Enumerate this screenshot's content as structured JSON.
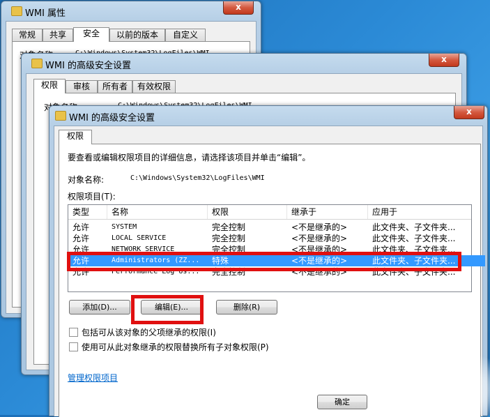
{
  "window_back": {
    "title": "WMI 属性",
    "close": "x",
    "tabs": [
      "常规",
      "共享",
      "安全",
      "以前的版本",
      "自定义"
    ],
    "object_label": "对象名称:",
    "object_value": "C:\\Windows\\System32\\LogFiles\\WMI",
    "left_fragment_1": "有",
    "left_fragment_2": "练"
  },
  "window_mid": {
    "title": "WMI 的高级安全设置",
    "close": "x",
    "tabs": [
      "权限",
      "审核",
      "所有者",
      "有效权限"
    ],
    "object_label": "对象名称:",
    "object_value": "C:\\Windows\\System32\\LogFiles\\WMI"
  },
  "window_front": {
    "title": "WMI 的高级安全设置",
    "close": "x",
    "tab": "权限",
    "instruction": "要查看或编辑权限项目的详细信息，请选择该项目并单击“编辑”。",
    "object_label": "对象名称:",
    "object_value": "C:\\Windows\\System32\\LogFiles\\WMI",
    "entries_label": "权限项目(T):",
    "columns": [
      "类型",
      "名称",
      "权限",
      "继承于",
      "应用于"
    ],
    "rows": [
      {
        "type": "允许",
        "name": "SYSTEM",
        "perm": "完全控制",
        "inherit": "<不是继承的>",
        "apply": "此文件夹、子文件夹..."
      },
      {
        "type": "允许",
        "name": "LOCAL SERVICE",
        "perm": "完全控制",
        "inherit": "<不是继承的>",
        "apply": "此文件夹、子文件夹..."
      },
      {
        "type": "允许",
        "name": "NETWORK SERVICE",
        "perm": "完全控制",
        "inherit": "<不是继承的>",
        "apply": "此文件夹、子文件夹..."
      },
      {
        "type": "允许",
        "name": "Administrators (ZZ...",
        "perm": "特殊",
        "inherit": "<不是继承的>",
        "apply": "此文件夹、子文件夹..."
      },
      {
        "type": "允许",
        "name": "Performance Log Us...",
        "perm": "完全控制",
        "inherit": "<不是继承的>",
        "apply": "此文件夹、子文件夹..."
      }
    ],
    "buttons": {
      "add": "添加(D)...",
      "edit": "编辑(E)...",
      "remove": "删除(R)"
    },
    "check_inherit": "包括可从该对象的父项继承的权限(I)",
    "check_replace": "使用可从此对象继承的权限替换所有子对象权限(P)",
    "manage_link": "管理权限项目",
    "ok": "确定"
  },
  "colors": {
    "selection": "#3399ff",
    "highlight_box": "#e01010",
    "link": "#0066cc"
  }
}
